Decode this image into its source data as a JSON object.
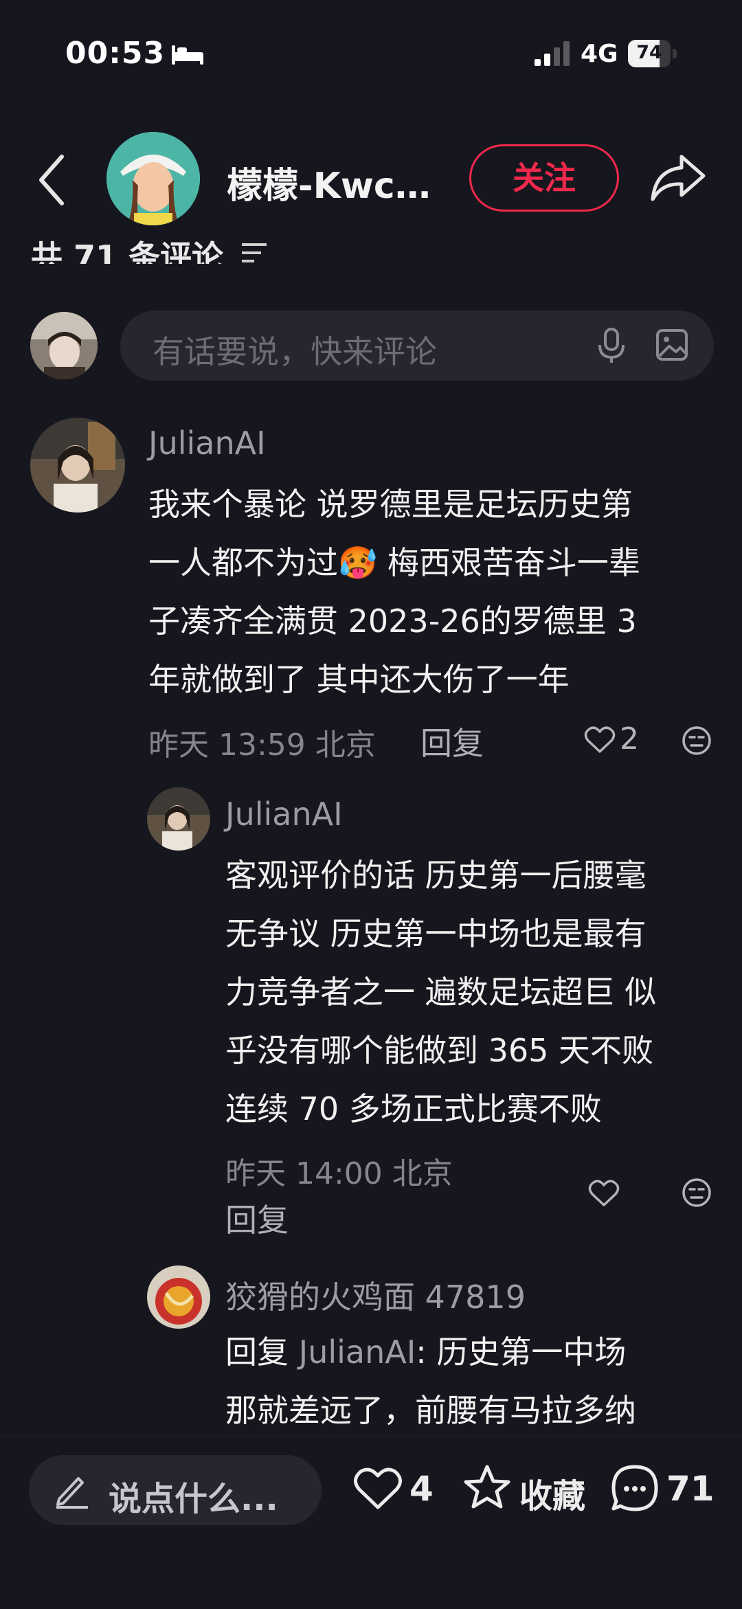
{
  "status": {
    "time": "00:53",
    "network": "4G",
    "battery": "74",
    "battery_level": 0.74
  },
  "header": {
    "author_name": "檬檬-Kwc...",
    "follow_label": "关注",
    "comment_count": "共 71 条评论"
  },
  "composer": {
    "placeholder": "有话要说，快来评论"
  },
  "comments": [
    {
      "user": "JulianAI",
      "lines": [
        "我来个暴论 说罗德里是足坛历史第",
        "一人都不为过🥵 梅西艰苦奋斗一辈",
        "子凑齐全满贯 2023-26的罗德里 3",
        "年就做到了 其中还大伤了一年"
      ],
      "meta": "昨天 13:59 北京",
      "reply_label": "回复",
      "likes": "2",
      "replies": [
        {
          "user": "JulianAI",
          "lines": [
            "客观评价的话 历史第一后腰毫",
            "无争议 历史第一中场也是最有",
            "力竞争者之一 遍数足坛超巨 似",
            "乎没有哪个能做到 365 天不败",
            "连续 70 多场正式比赛不败"
          ],
          "meta": "昨天 14:00 北京",
          "reply_label": "回复"
        },
        {
          "user": "狡猾的火鸡面 47819",
          "reply_prefix": "回复 ",
          "reply_to": "JulianAI",
          "line1_rest": ": 历史第一中场",
          "line2": "那就差远了，前腰有马拉多纳"
        }
      ]
    }
  ],
  "bottom": {
    "say_placeholder": "说点什么...",
    "likes": "4",
    "favorite_label": "收藏",
    "comments": "71"
  }
}
